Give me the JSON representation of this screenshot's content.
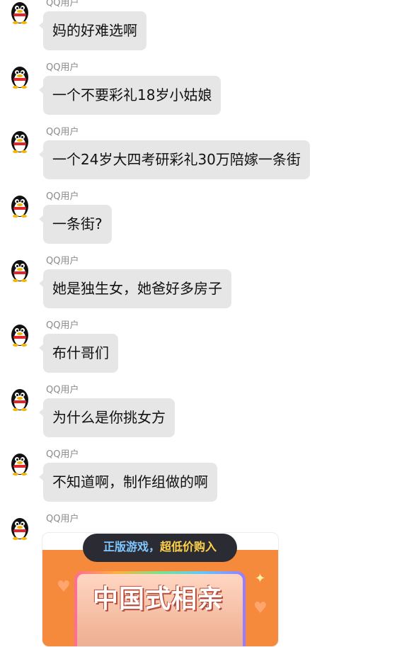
{
  "sender_name": "QQ用户",
  "messages": [
    {
      "text": "妈的好难选啊"
    },
    {
      "text": "一个不要彩礼18岁小姑娘"
    },
    {
      "text": "一个24岁大四考研彩礼30万陪嫁一条街"
    },
    {
      "text": "一条街?"
    },
    {
      "text": "她是独生女，她爸好多房子"
    },
    {
      "text": "布什哥们"
    },
    {
      "text": "为什么是你挑女方"
    },
    {
      "text": "不知道啊，制作组做的啊"
    }
  ],
  "card": {
    "tag_part1": "正版游戏，",
    "tag_part2": "超低价购入",
    "poster_title": "中国式相亲"
  },
  "colors": {
    "bubble": "#e6e6e6",
    "card_orange": "#f58a3c"
  },
  "icons": {
    "avatar": "qq-penguin-icon"
  }
}
